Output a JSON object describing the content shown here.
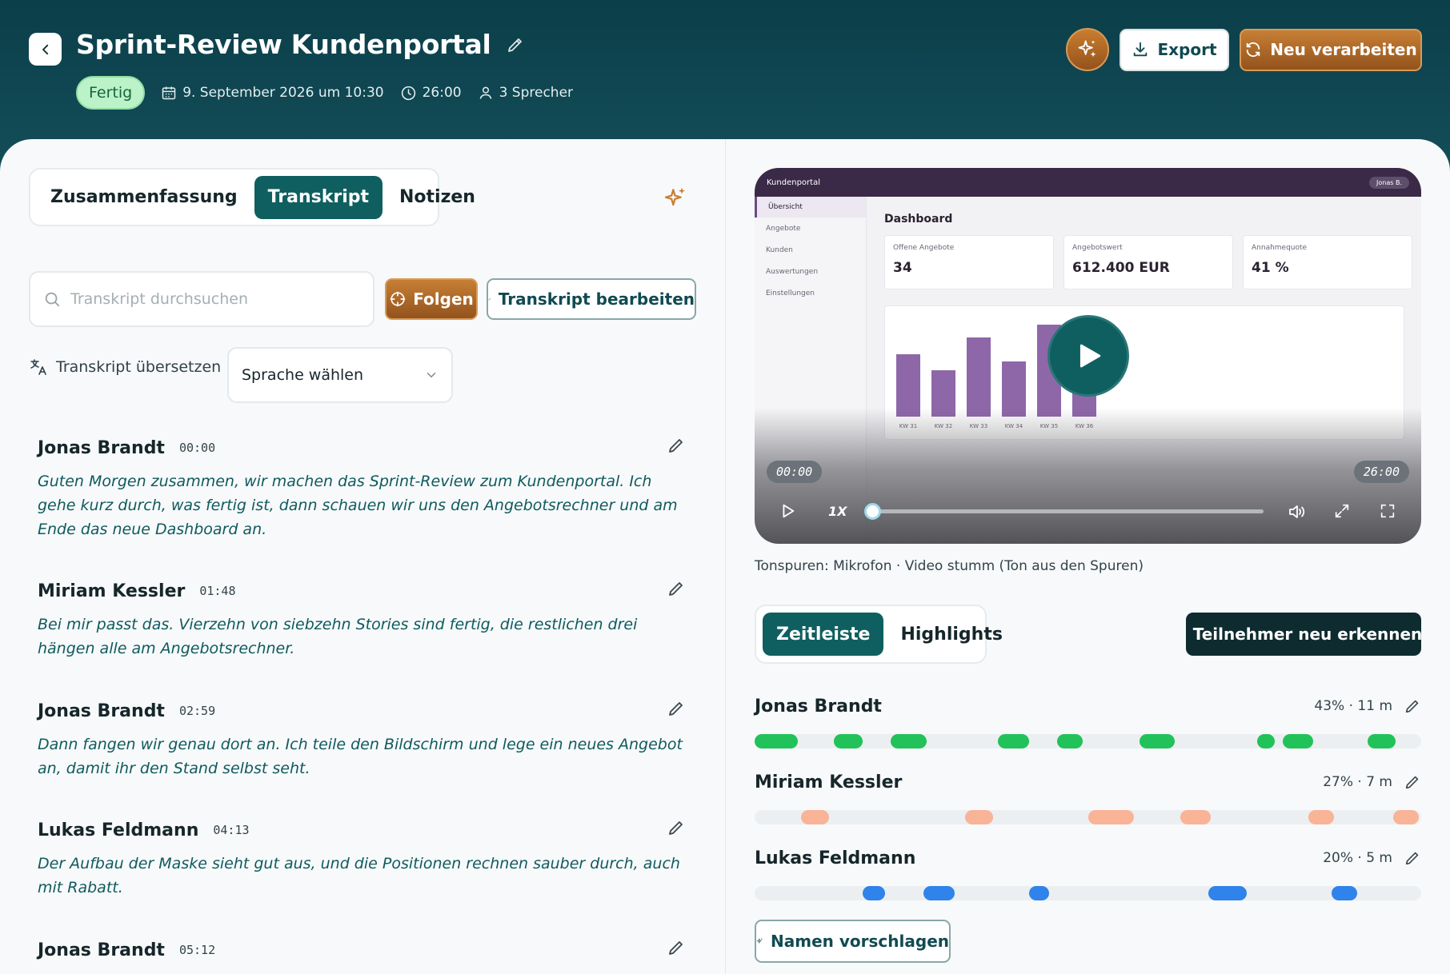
{
  "header": {
    "title": "Sprint-Review Kundenportal",
    "status": "Fertig",
    "date": "9. September 2026 um 10:30",
    "duration": "26:00",
    "speakers_count": "3 Sprecher",
    "export_label": "Export",
    "reprocess_label": "Neu verarbeiten"
  },
  "tabs": {
    "summary": "Zusammenfassung",
    "transcript": "Transkript",
    "notes": "Notizen",
    "active": "Transkript"
  },
  "toolbar": {
    "search_placeholder": "Transkript durchsuchen",
    "follow_label": "Folgen",
    "edit_label": "Transkript bearbeiten",
    "translate_label": "Transkript übersetzen",
    "language_placeholder": "Sprache wählen"
  },
  "transcript": [
    {
      "speaker": "Jonas Brandt",
      "time": "00:00",
      "text": "Guten Morgen zusammen, wir machen das Sprint-Review zum Kundenportal. Ich gehe kurz durch, was fertig ist, dann schauen wir uns den Angebotsrechner und am Ende das neue Dashboard an."
    },
    {
      "speaker": "Miriam Kessler",
      "time": "01:48",
      "text": "Bei mir passt das. Vierzehn von siebzehn Stories sind fertig, die restlichen drei hängen alle am Angebotsrechner."
    },
    {
      "speaker": "Jonas Brandt",
      "time": "02:59",
      "text": "Dann fangen wir genau dort an. Ich teile den Bildschirm und lege ein neues Angebot an, damit ihr den Stand selbst seht."
    },
    {
      "speaker": "Lukas Feldmann",
      "time": "04:13",
      "text": "Der Aufbau der Maske sieht gut aus, und die Positionen rechnen sauber durch, auch mit Rabatt."
    },
    {
      "speaker": "Jonas Brandt",
      "time": "05:12",
      "text": ""
    }
  ],
  "video": {
    "app_name": "Kundenportal",
    "user_chip": "Jonas B.",
    "nav": [
      "Übersicht",
      "Angebote",
      "Kunden",
      "Auswertungen",
      "Einstellungen"
    ],
    "heading": "Dashboard",
    "cards": [
      {
        "label": "Offene Angebote",
        "value": "34"
      },
      {
        "label": "Angebotswert",
        "value": "612.400 EUR"
      },
      {
        "label": "Annahmequote",
        "value": "41 %"
      }
    ],
    "chart": {
      "categories": [
        "KW 31",
        "KW 32",
        "KW 33",
        "KW 34",
        "KW 35",
        "KW 36"
      ],
      "values": [
        68,
        50,
        86,
        60,
        100,
        40
      ],
      "bar_color": "#8e67a9"
    },
    "current_time": "00:00",
    "total_time": "26:00",
    "speed": "1X",
    "progress": 0
  },
  "tracks_note": "Tonspuren: Mikrofon · Video stumm (Ton aus den Spuren)",
  "timeline": {
    "tabs": {
      "timeline": "Zeitleiste",
      "highlights": "Highlights",
      "active": "Zeitleiste"
    },
    "detect_label": "Teilnehmer neu erkennen",
    "suggest_label": "Namen vorschlagen",
    "total_minutes": 26,
    "speakers": [
      {
        "name": "Jonas Brandt",
        "stat": "43% · 11 m",
        "color": "#22c25a",
        "segments": [
          [
            0,
            1.7
          ],
          [
            3.1,
            4.2
          ],
          [
            5.3,
            6.7
          ],
          [
            9.5,
            10.7
          ],
          [
            11.8,
            12.8
          ],
          [
            15,
            16.4
          ],
          [
            19.6,
            20.3
          ],
          [
            20.6,
            21.8
          ],
          [
            23.9,
            25
          ]
        ]
      },
      {
        "name": "Miriam Kessler",
        "stat": "27% · 7 m",
        "color": "#f9b397",
        "segments": [
          [
            1.8,
            2.9
          ],
          [
            8.2,
            9.3
          ],
          [
            13,
            14.8
          ],
          [
            16.6,
            17.8
          ],
          [
            21.6,
            22.6
          ],
          [
            24.9,
            25.9
          ]
        ]
      },
      {
        "name": "Lukas Feldmann",
        "stat": "20% · 5 m",
        "color": "#2f83ea",
        "segments": [
          [
            4.2,
            5.1
          ],
          [
            6.6,
            7.8
          ],
          [
            10.7,
            11.5
          ],
          [
            17.7,
            19.2
          ],
          [
            22.5,
            23.5
          ]
        ]
      }
    ]
  },
  "colors": {
    "header_bg": "#0b3f4a",
    "accent_teal": "#0f5f60",
    "accent_orange": "#c77f35",
    "status_bg": "#bcf2c8",
    "transcript_text": "#0f5a5e"
  }
}
